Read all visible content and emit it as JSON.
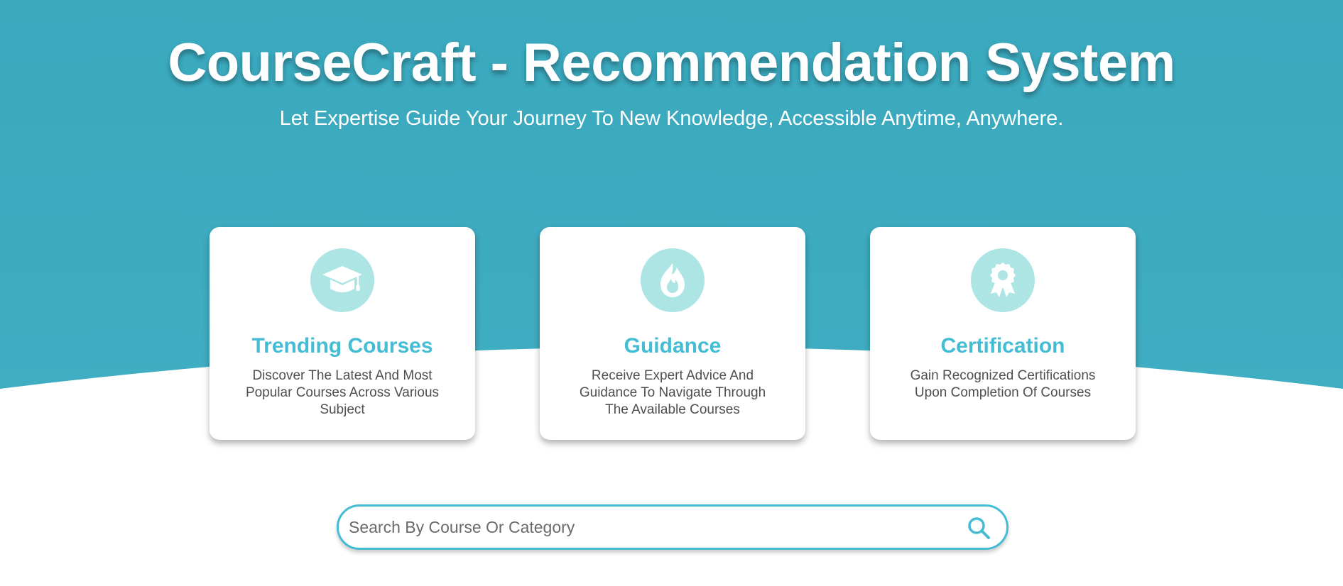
{
  "hero": {
    "title": "CourseCraft - Recommendation System",
    "subtitle": "Let Expertise Guide Your Journey To New Knowledge, Accessible Anytime, Anywhere."
  },
  "features": [
    {
      "icon": "graduation-cap-icon",
      "title": "Trending Courses",
      "description": "Discover The Latest And Most Popular Courses Across Various Subject"
    },
    {
      "icon": "fire-icon",
      "title": "Guidance",
      "description": "Receive Expert Advice And Guidance To Navigate Through The Available Courses"
    },
    {
      "icon": "award-icon",
      "title": "Certification",
      "description": "Gain Recognized Certifications Upon Completion Of Courses"
    }
  ],
  "search": {
    "placeholder": "Search By Course Or Category",
    "value": "",
    "icon": "search-icon"
  },
  "colors": {
    "hero_background": "#3ba9be",
    "accent": "#44bdd4",
    "icon_circle": "#ade4e4",
    "card_text": "#4f4f4f"
  }
}
